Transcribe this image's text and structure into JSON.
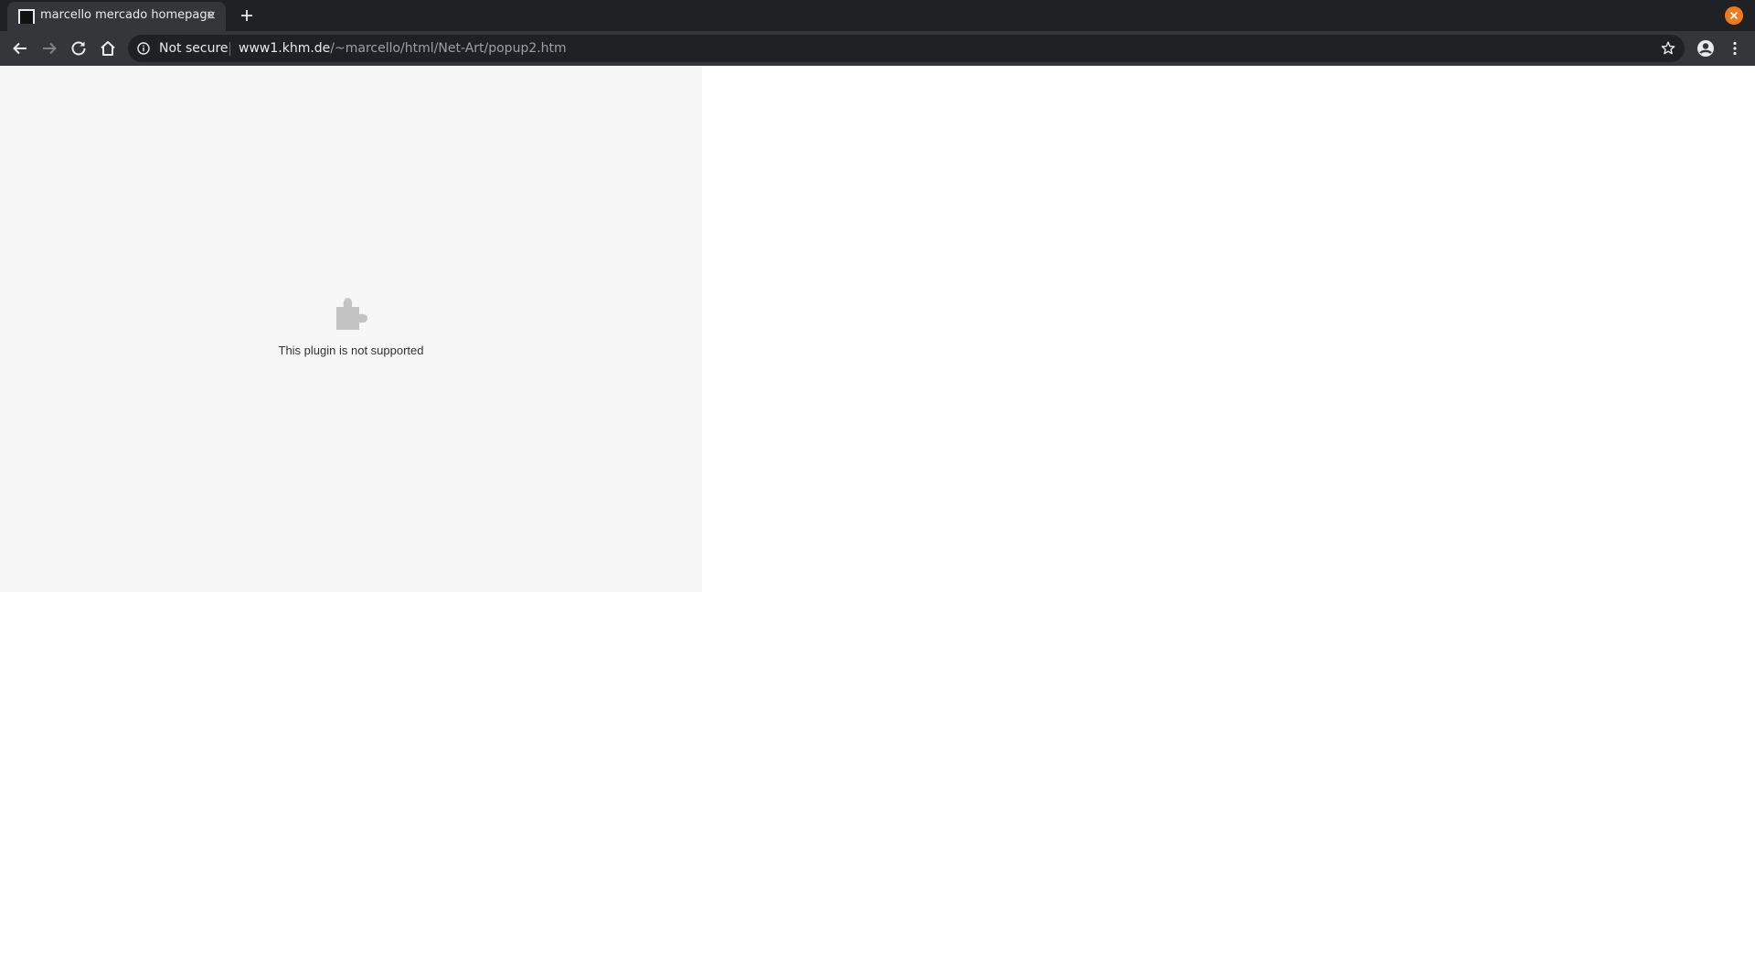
{
  "browser": {
    "tab": {
      "title": "marcello mercado homepage",
      "close_glyph": "×",
      "favicon": "page-favicon"
    },
    "new_tab_icon": "plus-icon",
    "window_close_color": "#f07a1a",
    "toolbar": {
      "back_icon": "arrow-left-icon",
      "forward_icon": "arrow-right-icon",
      "reload_icon": "reload-icon",
      "home_icon": "home-icon",
      "bookmark_icon": "star-icon",
      "profile_icon": "account-circle-icon",
      "menu_icon": "kebab-menu-icon"
    },
    "omnibox": {
      "security_label": "Not secure",
      "url_host": "www1.khm.de",
      "url_path": "/~marcello/html/Net-Art/popup2.htm"
    }
  },
  "page": {
    "plugin_message": "This plugin is not supported",
    "plugin_icon": "puzzle-piece-icon"
  }
}
